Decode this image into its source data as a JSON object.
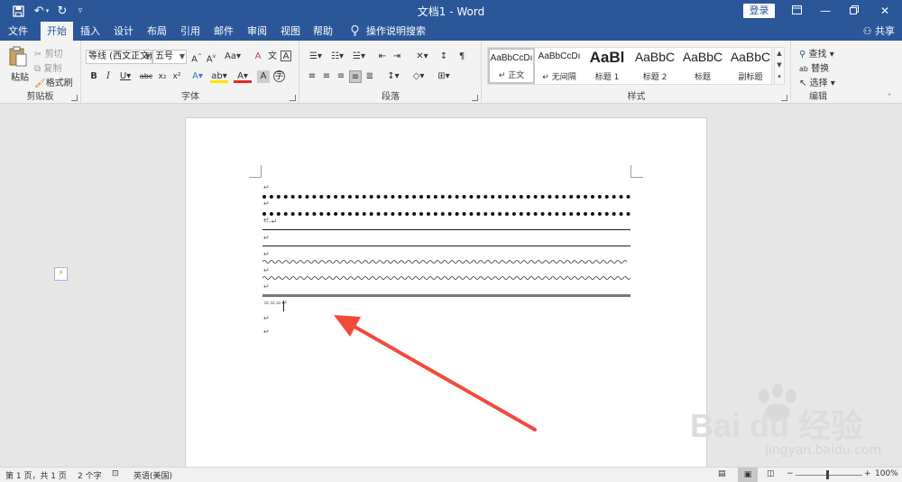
{
  "window": {
    "doc_title": "文档1 - Word",
    "login": "登录"
  },
  "tabs": [
    "文件",
    "开始",
    "插入",
    "设计",
    "布局",
    "引用",
    "邮件",
    "审阅",
    "视图",
    "帮助"
  ],
  "search_tab": "操作说明搜索",
  "share": "共享",
  "clipboard": {
    "paste": "粘贴",
    "cut": "剪切",
    "copy": "复制",
    "format_painter": "格式刷",
    "label": "剪贴板"
  },
  "font": {
    "name": "等线 (西文正文)",
    "size": "五号",
    "label": "字体"
  },
  "paragraph": {
    "label": "段落"
  },
  "styles": {
    "label": "样式",
    "items": [
      {
        "sample": "AaBbCcDı",
        "name": "↵ 正文"
      },
      {
        "sample": "AaBbCcDı",
        "name": "↵ 无间隔"
      },
      {
        "sample": "AaBl",
        "name": "标题 1"
      },
      {
        "sample": "AaBbC",
        "name": "标题 2"
      },
      {
        "sample": "AaBbC",
        "name": "标题"
      },
      {
        "sample": "AaBbC",
        "name": "副标题"
      }
    ]
  },
  "editing": {
    "find": "查找",
    "replace": "替换",
    "select": "选择",
    "label": "编辑"
  },
  "document": {
    "lines": [
      "↵",
      "↵",
      "↵",
      "---↵",
      "↵",
      "↵",
      "↵",
      "↵",
      "===↵",
      "↵",
      "↵"
    ]
  },
  "watermark": {
    "brand": "Bai du 经验",
    "url": "jingyan.baidu.com"
  },
  "status": {
    "page": "第 1 页，共 1 页",
    "words": "2 个字",
    "language": "英语(美国)",
    "zoom": "100%"
  },
  "colors": {
    "brand": "#2b579a",
    "arrow": "#f24a3a"
  }
}
